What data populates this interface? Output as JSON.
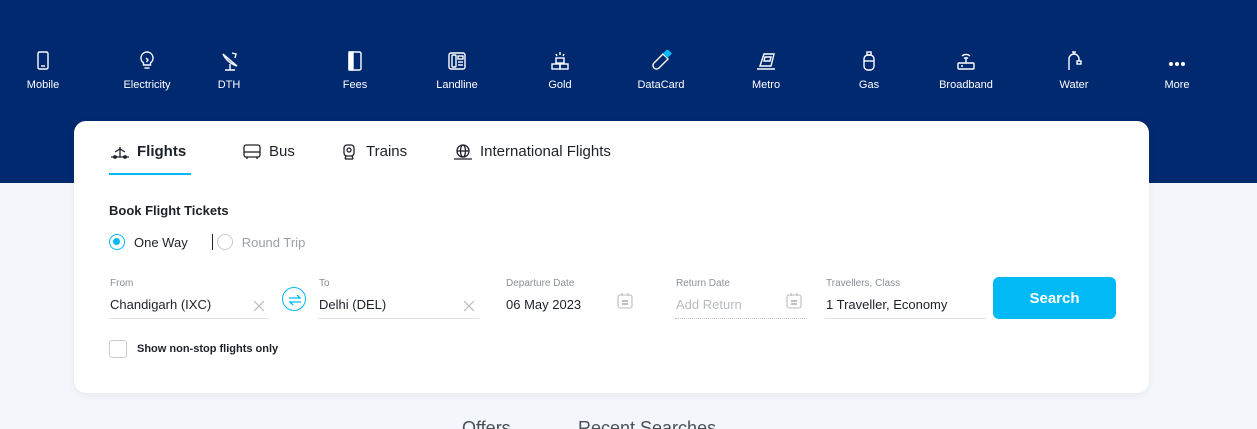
{
  "services": [
    {
      "label": "Mobile",
      "icon": "mobile-icon"
    },
    {
      "label": "Electricity",
      "icon": "bulb-icon"
    },
    {
      "label": "DTH",
      "icon": "satellite-dish-icon"
    },
    {
      "label": "Fees",
      "icon": "book-icon"
    },
    {
      "label": "Landline",
      "icon": "landline-phone-icon"
    },
    {
      "label": "Gold",
      "icon": "gold-bars-icon"
    },
    {
      "label": "DataCard",
      "icon": "usb-stick-icon"
    },
    {
      "label": "Metro",
      "icon": "metro-train-icon"
    },
    {
      "label": "Gas",
      "icon": "gas-cylinder-icon"
    },
    {
      "label": "Broadband",
      "icon": "router-icon"
    },
    {
      "label": "Water",
      "icon": "water-tap-icon"
    },
    {
      "label": "More",
      "icon": "more-dots-icon"
    }
  ],
  "tabs": [
    {
      "label": "Flights",
      "icon": "flight-icon",
      "active": true
    },
    {
      "label": "Bus",
      "icon": "bus-icon",
      "active": false
    },
    {
      "label": "Trains",
      "icon": "train-icon",
      "active": false
    },
    {
      "label": "International Flights",
      "icon": "globe-flight-icon",
      "active": false
    }
  ],
  "section_title": "Book Flight Tickets",
  "trip_types": {
    "one_way": "One Way",
    "round_trip": "Round Trip",
    "selected": "One Way"
  },
  "form": {
    "from": {
      "label": "From",
      "value": "Chandigarh (IXC)"
    },
    "to": {
      "label": "To",
      "value": "Delhi (DEL)"
    },
    "departure": {
      "label": "Departure Date",
      "value": "06 May 2023"
    },
    "return": {
      "label": "Return Date",
      "placeholder": "Add Return"
    },
    "travellers": {
      "label": "Travellers, Class",
      "value": "1 Traveller, Economy"
    },
    "search_label": "Search",
    "nonstop_label": "Show non-stop flights only"
  },
  "bottom_tabs": [
    "Offers",
    "Recent Searches"
  ],
  "colors": {
    "header": "#002970",
    "accent": "#00b9f5",
    "background": "#f3f7fb"
  }
}
